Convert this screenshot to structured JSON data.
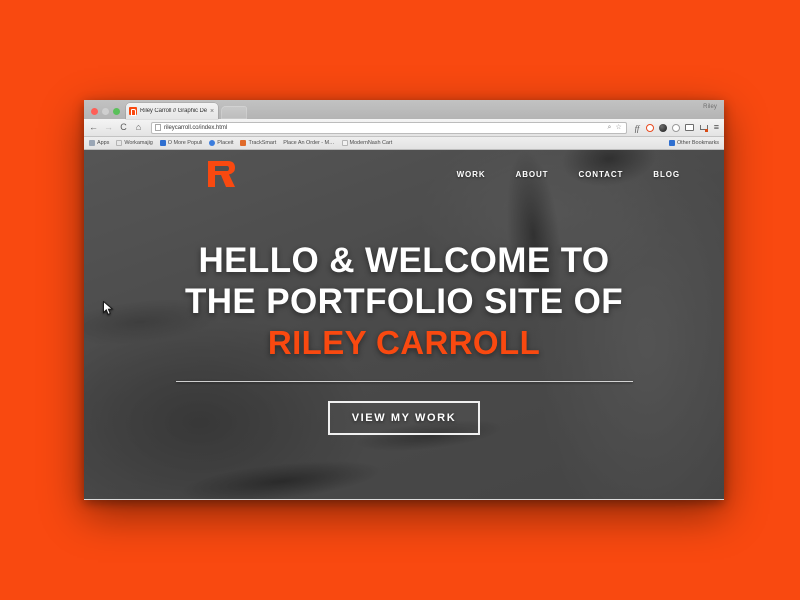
{
  "desktop": {
    "background_color": "#f94910"
  },
  "browser": {
    "profile_name": "Riley",
    "tab": {
      "title": "Riley Carroll // Graphic De",
      "close_label": "×",
      "favicon_name": "site-favicon"
    },
    "toolbar": {
      "back_label": "←",
      "forward_label": "→",
      "reload_label": "C",
      "home_label": "⌂",
      "url": "rileycarroll.co/index.html",
      "search_icon": "⌕",
      "bookmark_star_icon": "☆",
      "menu_icon": "≡",
      "extensions": [
        {
          "name": "font-extension-icon",
          "label": "ff"
        },
        {
          "name": "ring-extension-icon",
          "label": ""
        },
        {
          "name": "dark-circle-extension-icon",
          "label": ""
        },
        {
          "name": "gray-circle-extension-icon",
          "label": ""
        },
        {
          "name": "window-extension-icon",
          "label": ""
        },
        {
          "name": "cart-extension-icon",
          "label": ""
        }
      ]
    },
    "bookmarks": {
      "items": [
        {
          "label": "Apps",
          "color": "#9aa6b5"
        },
        {
          "label": "Workamajig",
          "color": "#e7e7e7"
        },
        {
          "label": "O More Populi",
          "color": "#2f6fd0"
        },
        {
          "label": "Placeit",
          "color": "#3b7ddd"
        },
        {
          "label": "TrackSmart",
          "color": "#e06a2a"
        },
        {
          "label": "Place An Order - M…",
          "color": ""
        },
        {
          "label": "ModernNash Cart",
          "color": "#e7e7e7"
        }
      ],
      "other_label": "Other Bookmarks",
      "other_icon_color": "#2f6fd0"
    }
  },
  "site": {
    "logo_name": "riley-carroll-r-logo",
    "accent_color": "#f94910",
    "nav": [
      {
        "label": "WORK"
      },
      {
        "label": "ABOUT"
      },
      {
        "label": "CONTACT"
      },
      {
        "label": "BLOG"
      }
    ],
    "hero": {
      "line1": "HELLO & WELCOME TO",
      "line2": "THE PORTFOLIO SITE OF",
      "line3": "RILEY CARROLL",
      "cta_label": "VIEW MY WORK"
    }
  }
}
